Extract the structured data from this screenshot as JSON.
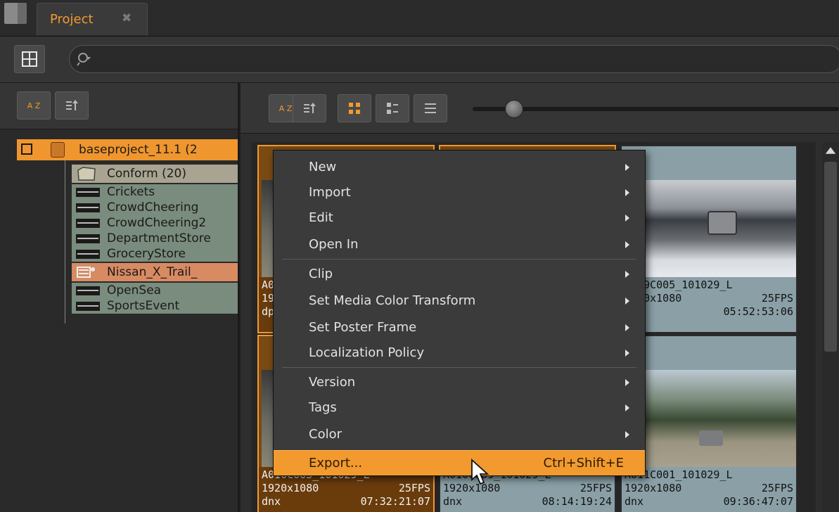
{
  "tab": {
    "title": "Project",
    "close": "✖"
  },
  "left_tree": {
    "root": "baseproject_11.1 (2",
    "bin": "Conform (20)",
    "clips": [
      {
        "label": "Crickets"
      },
      {
        "label": "CrowdCheering"
      },
      {
        "label": "CrowdCheering2"
      },
      {
        "label": "DepartmentStore"
      },
      {
        "label": "GroceryStore"
      },
      {
        "label": "Nissan_X_Trail_"
      },
      {
        "label": "OpenSea"
      },
      {
        "label": "SportsEvent"
      }
    ]
  },
  "sort": {
    "az_label": "A Z"
  },
  "tiles": [
    {
      "name": "A0",
      "res": "19",
      "fps": "",
      "tc": "",
      "codec": "dp"
    },
    {
      "name": "A009C005_101029_L",
      "res": "1920x1080",
      "fps": "25FPS",
      "tc": "05:52:53:06",
      "codec": "dnx"
    },
    {
      "name": "A010C003_101029_L",
      "res": "1920x1080",
      "fps": "25FPS",
      "tc": "07:32:21:07",
      "codec": "dnx"
    },
    {
      "name": "A010C009_101029_L",
      "res": "1920x1080",
      "fps": "25FPS",
      "tc": "08:14:19:24",
      "codec": "dnx"
    },
    {
      "name": "A011C001_101029_L",
      "res": "1920x1080",
      "fps": "25FPS",
      "tc": "09:36:47:07",
      "codec": "dnx"
    }
  ],
  "context_menu": {
    "items": [
      {
        "label": "New",
        "submenu": true
      },
      {
        "label": "Import",
        "submenu": true
      },
      {
        "label": "Edit",
        "submenu": true
      },
      {
        "label": "Open In",
        "submenu": true
      },
      {
        "label": "Clip",
        "submenu": true
      },
      {
        "label": "Set Media Color Transform",
        "submenu": true
      },
      {
        "label": "Set Poster Frame",
        "submenu": true
      },
      {
        "label": "Localization Policy",
        "submenu": true
      },
      {
        "label": "Version",
        "submenu": true
      },
      {
        "label": "Tags",
        "submenu": true
      },
      {
        "label": "Color",
        "submenu": true
      },
      {
        "label": "Export...",
        "shortcut": "Ctrl+Shift+E",
        "highlighted": true
      }
    ]
  },
  "colors": {
    "accent": "#f29a2e",
    "selected_tile": "#6a3c0c",
    "tile": "#8aa0a6",
    "bin": "#a8a491",
    "clip": "#7a8c7d"
  }
}
